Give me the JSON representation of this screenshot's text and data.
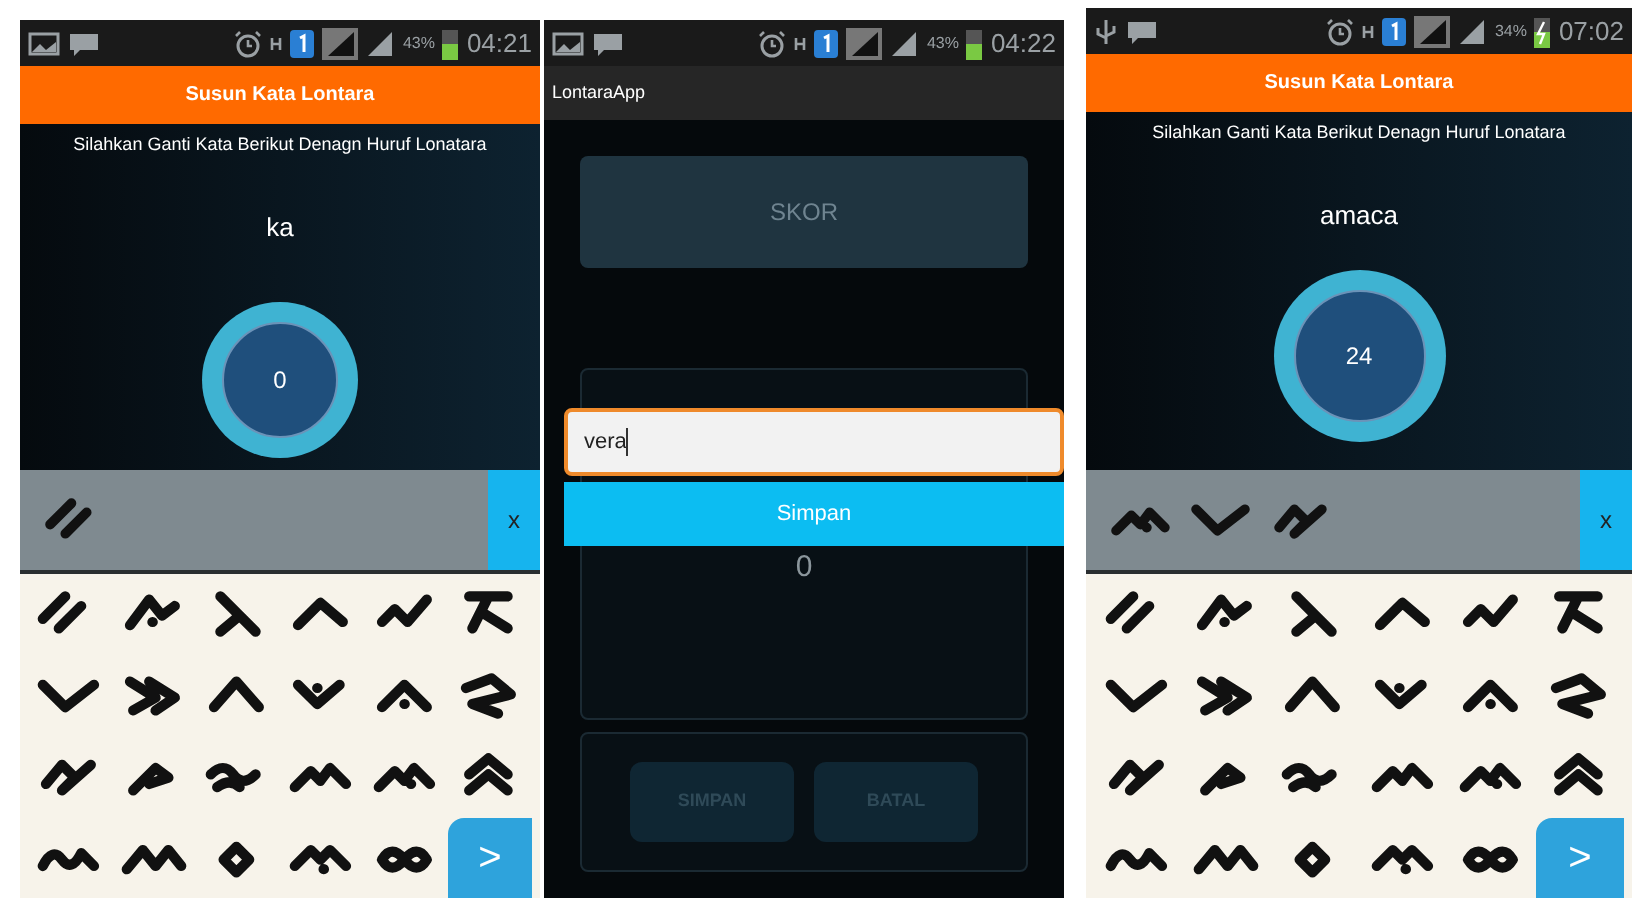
{
  "screens": [
    {
      "kind": "game",
      "status": {
        "usb": false,
        "charging": false,
        "battery": "43%",
        "time": "04:21"
      },
      "title": "Susun Kata Lontara",
      "instruction": "Silahkan Ganti Kata Berikut Denagn Huruf Lonatara",
      "word": "ka",
      "score": "0",
      "clear_label": "x",
      "next_label": ">"
    },
    {
      "kind": "score",
      "status": {
        "usb": false,
        "charging": false,
        "battery": "43%",
        "time": "04:22"
      },
      "app_title": "LontaraApp",
      "card_title": "SKOR",
      "name_input": {
        "value": "vera"
      },
      "save_button": "Simpan",
      "score": "0",
      "buttons": [
        {
          "label": "SIMPAN",
          "disabled": true
        },
        {
          "label": "BATAL",
          "disabled": true
        }
      ]
    },
    {
      "kind": "game",
      "status": {
        "usb": true,
        "charging": true,
        "battery": "34%",
        "time": "07:02"
      },
      "title": "Susun Kata Lontara",
      "instruction": "Silahkan Ganti Kata Berikut Denagn Huruf Lonatara",
      "word": "amaca",
      "score": "24",
      "clear_label": "x",
      "next_label": ">"
    }
  ]
}
